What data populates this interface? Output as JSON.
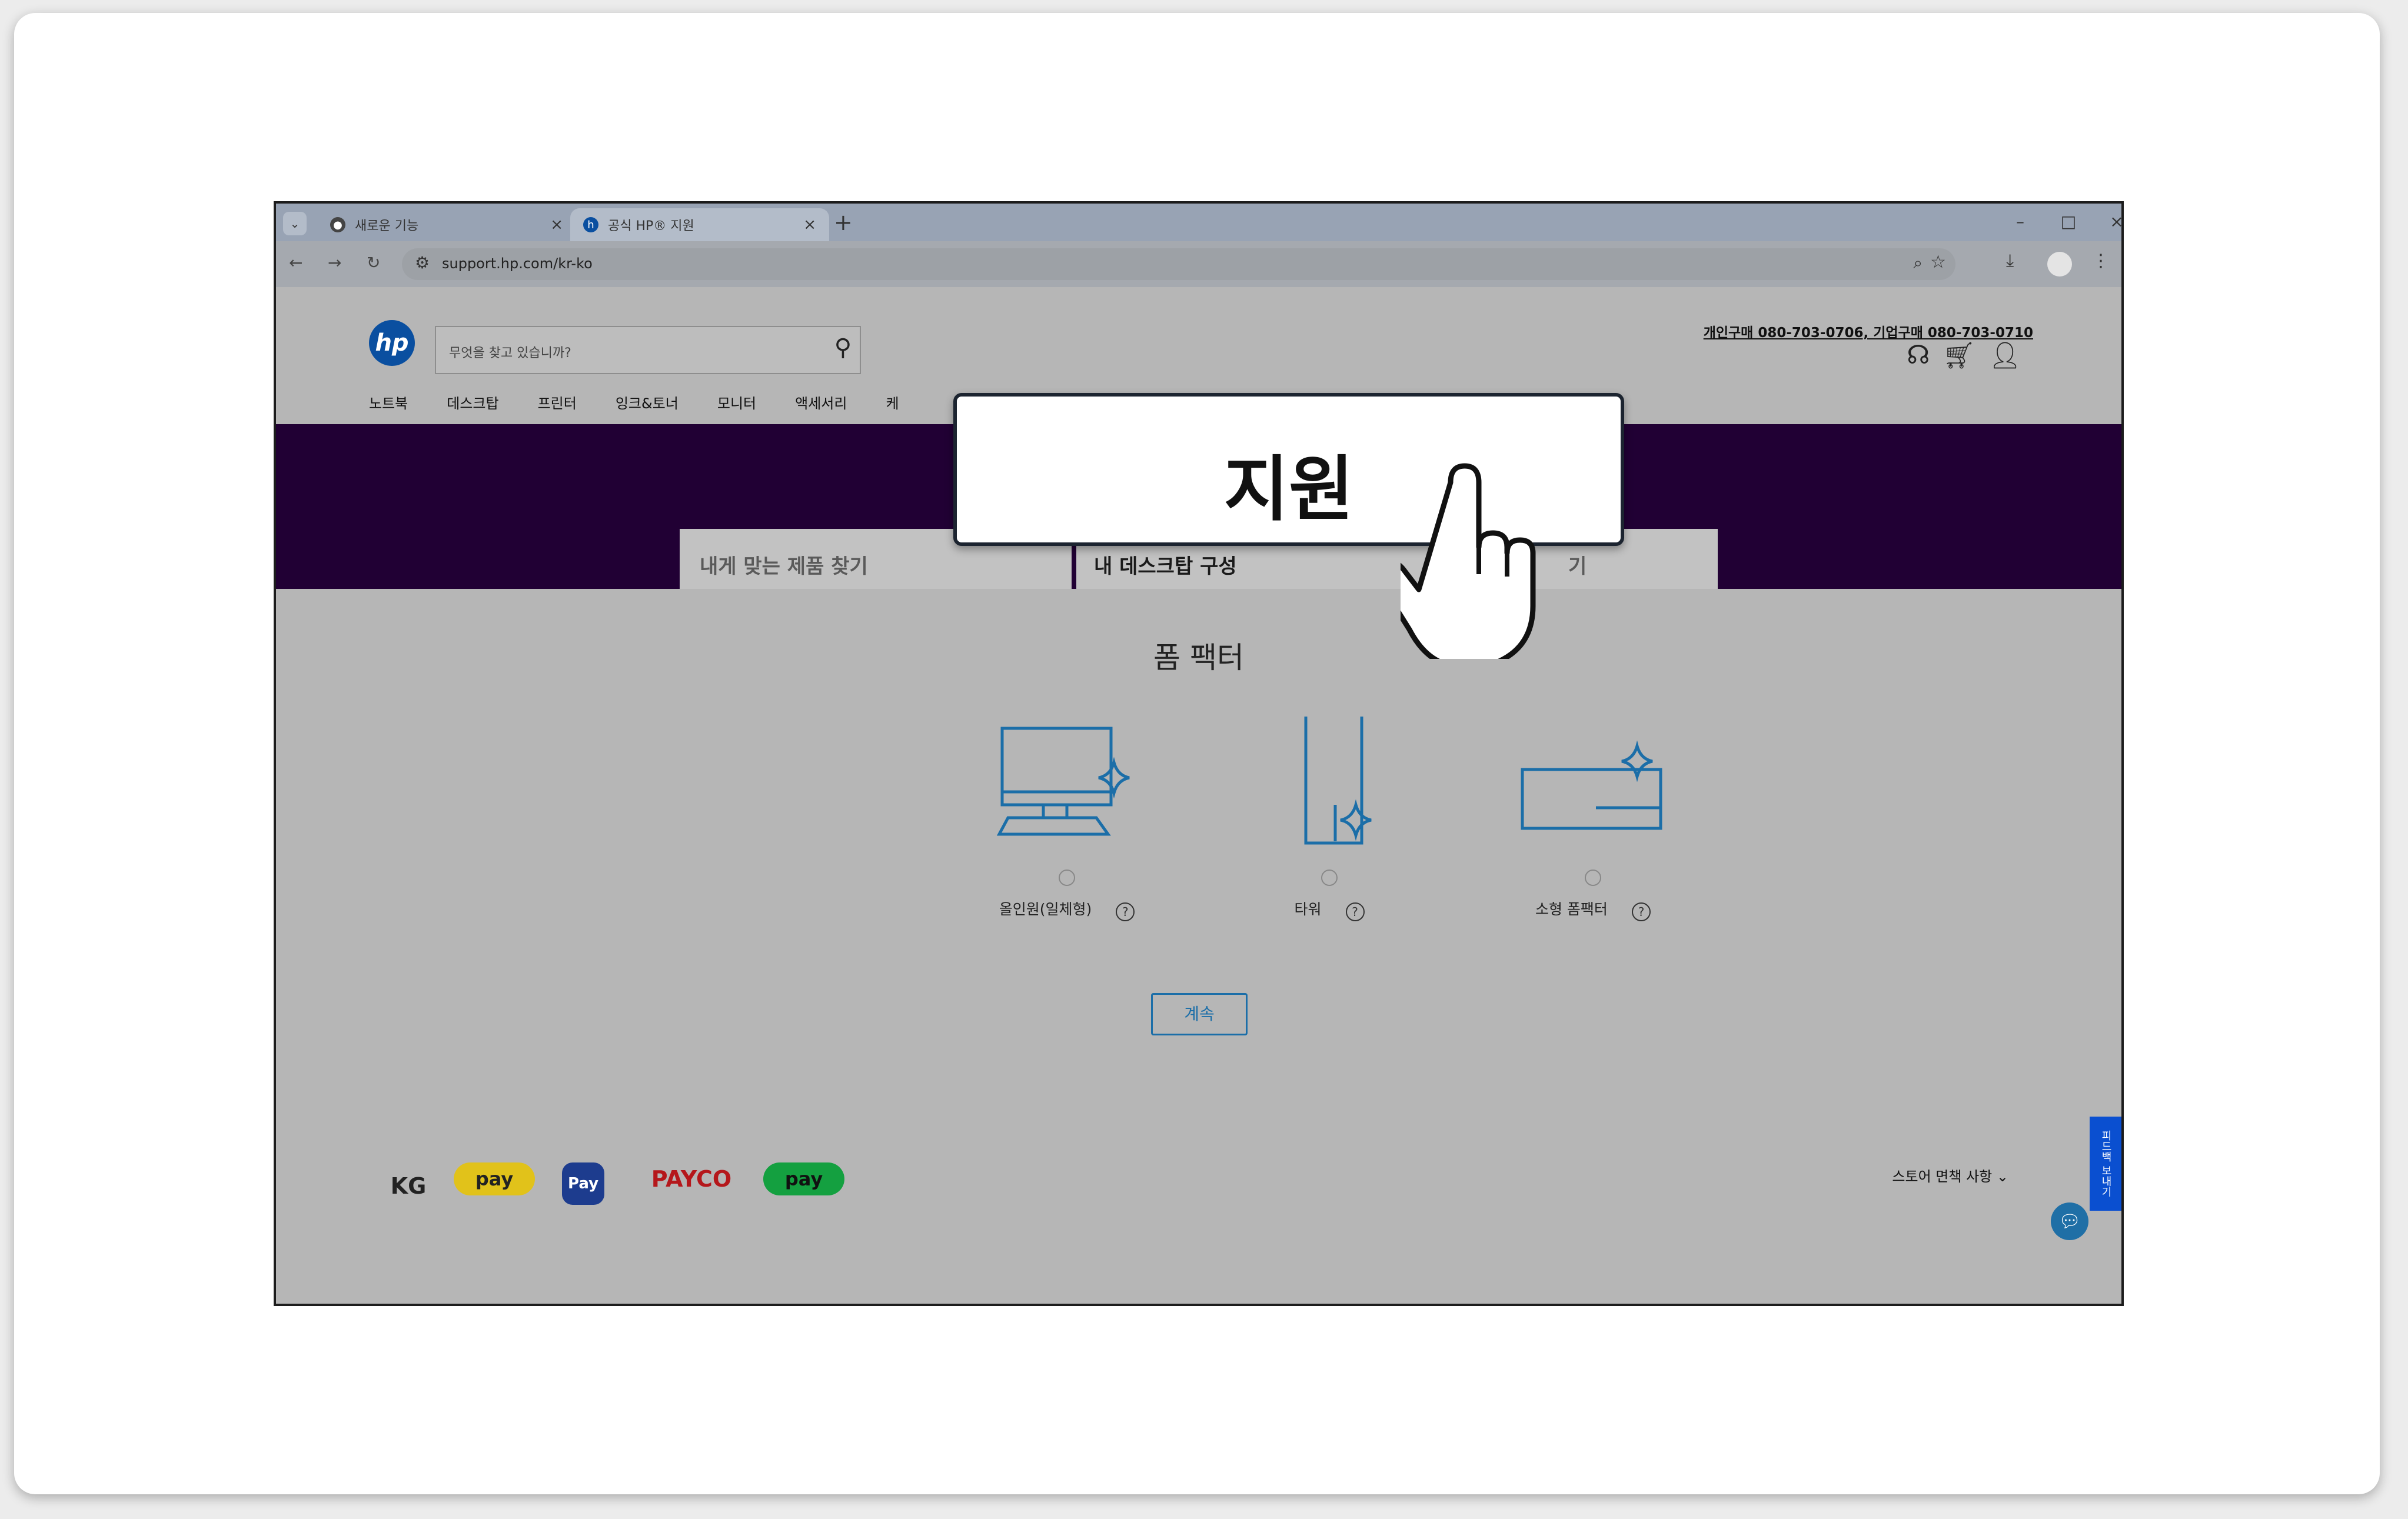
{
  "browser": {
    "tabs": [
      {
        "title": "새로운 기능",
        "icon": "chrome-icon"
      },
      {
        "title": "공식 HP® 지원",
        "icon": "hp-favicon"
      }
    ],
    "url": "support.hp.com/kr-ko"
  },
  "header": {
    "search_placeholder": "무엇을 찾고 있습니까?",
    "contact": "개인구매 080-703-0706, 기업구매 080-703-0710",
    "nav": [
      "노트북",
      "데스크탑",
      "프린터",
      "잉크&토너",
      "모니터",
      "액세서리",
      "케"
    ]
  },
  "finder": {
    "tabs": [
      "내게 맞는 제품 찾기",
      "내 데스크탑 구성",
      "기"
    ],
    "section_title": "폼 팩터",
    "options": [
      {
        "label": "올인원(일체형)"
      },
      {
        "label": "타워"
      },
      {
        "label": "소형 폼팩터"
      }
    ],
    "help_glyph": "?",
    "continue_label": "계속"
  },
  "footer": {
    "payments": [
      "KG",
      "pay",
      "Pay",
      "PAYCO",
      "pay"
    ],
    "disclaimer": "스토어 면책 사항"
  },
  "feedback_label": "피드백 보내기",
  "callout": {
    "text": "지원"
  },
  "colors": {
    "hp_blue": "#0a4fa0",
    "banner_purple": "#210034",
    "accent_blue": "#1b6ea8"
  }
}
